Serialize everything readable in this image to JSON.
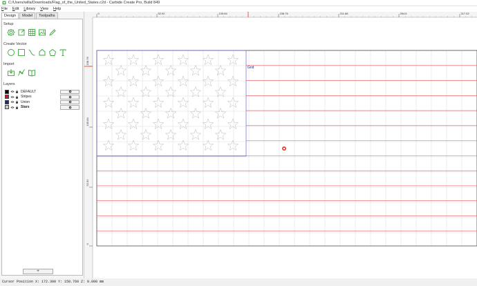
{
  "window": {
    "title": "C:/Users/willa/Downloads/Flag_of_the_United_States.c2d - Carbide Create Pro, Build 849"
  },
  "menu": [
    {
      "mnemonic": "F",
      "rest": "ile"
    },
    {
      "mnemonic": "E",
      "rest": "dit"
    },
    {
      "mnemonic": "L",
      "rest": "ibrary"
    },
    {
      "mnemonic": "V",
      "rest": "iew"
    },
    {
      "mnemonic": "H",
      "rest": "elp"
    }
  ],
  "tabs": [
    {
      "label": "Design",
      "active": true
    },
    {
      "label": "Model",
      "active": false
    },
    {
      "label": "Toolpaths",
      "active": false
    }
  ],
  "sections": {
    "setup": "Setup",
    "create_vector": "Create Vector",
    "import": "Import",
    "layers": "Layers"
  },
  "setup_tools": [
    "gear-outline-icon",
    "open-file-icon",
    "grid-icon",
    "image-icon",
    "pencil-icon"
  ],
  "create_tools": [
    "circle-icon",
    "rectangle-icon",
    "curve-icon",
    "polygon-icon",
    "pentagon-icon",
    "text-icon"
  ],
  "import_tools": [
    "import-icon",
    "svg-import-icon",
    "book-icon"
  ],
  "layers": [
    {
      "name": "DEFAULT",
      "color": "#000000",
      "bold": false
    },
    {
      "name": "Stripes",
      "color": "#b22234",
      "bold": false
    },
    {
      "name": "Union",
      "color": "#1c2a78",
      "bold": false
    },
    {
      "name": "Stars",
      "color": "#c8c8c8",
      "bold": true
    }
  ],
  "add_layer_label": "+",
  "rulers": {
    "top": [
      "0",
      "52.92",
      "105.84",
      "158.76",
      "211.68",
      "264.6",
      "317.52"
    ],
    "left": [
      "158.76",
      "105.84",
      "52.92",
      "0"
    ]
  },
  "canvas": {
    "grid_label": "Grid",
    "stripe_color": "#e8555b",
    "union_outline_color": "#6a6ad8",
    "cursor_line_color": "#e03a2a",
    "star_columns": [
      6,
      5
    ],
    "star_rows": 9
  },
  "status": {
    "text": "Cursor Position X: 172.300 Y: 158.760 Z: 0.000 mm"
  },
  "colors": {
    "accent": "#3aa63a"
  }
}
